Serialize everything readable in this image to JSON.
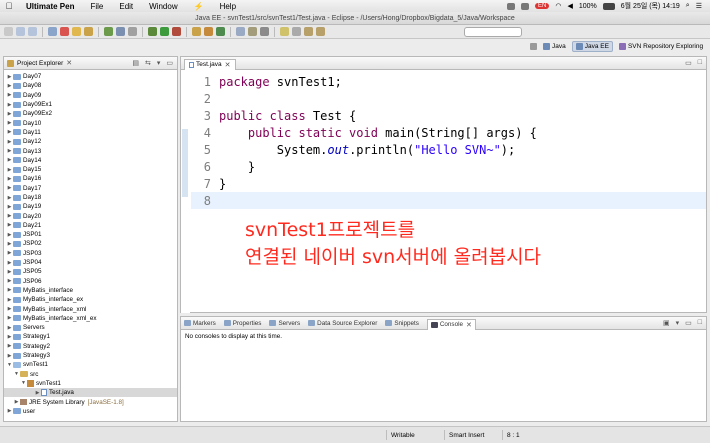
{
  "menubar": {
    "app_name": "Ultimate Pen",
    "items": [
      "File",
      "Edit",
      "Window",
      "Help"
    ],
    "battery": "100%",
    "datetime": "6월 25일 (목)  14:19"
  },
  "window": {
    "title": "Java EE - svnTest1/src/svnTest1/Test.java - Eclipse - /Users/Hong/Dropbox/Bigdata_5/Java/Workspace"
  },
  "perspectives": [
    "Java",
    "Java EE",
    "SVN Repository Exploring"
  ],
  "explorer": {
    "tab_label": "Project Explorer",
    "tab_close": "✕",
    "projects": [
      "Day07",
      "Day08",
      "Day09",
      "Day09Ex1",
      "Day09Ex2",
      "Day10",
      "Day11",
      "Day12",
      "Day13",
      "Day14",
      "Day15",
      "Day16",
      "Day17",
      "Day18",
      "Day19",
      "Day20",
      "Day21",
      "JSP01",
      "JSP02",
      "JSP03",
      "JSP04",
      "JSP05",
      "JSP06",
      "MyBatis_interface",
      "MyBatis_interface_ex",
      "MyBatis_interface_xml",
      "MyBatis_interface_xml_ex",
      "Servers",
      "Strategy1",
      "Strategy2",
      "Strategy3"
    ],
    "open_project": "svnTest1",
    "src_folder": "src",
    "package": "svnTest1",
    "file": "Test.java",
    "jre_label": "JRE System Library",
    "jre_version": "[JavaSE-1.8]",
    "last_project": "user"
  },
  "editor": {
    "tab_label": "Test.java",
    "tab_close": "✕",
    "line_numbers": [
      "1",
      "2",
      "3",
      "4",
      "5",
      "6",
      "7",
      "8"
    ],
    "code": {
      "l1_kw": "package",
      "l1_rest": " svnTest1;",
      "l3_kw": "public class",
      "l3_rest": " Test {",
      "l4_indent": "    ",
      "l4_kw": "public static void",
      "l4_rest": " main(String[] args) {",
      "l5_pre": "        System.",
      "l5_field": "out",
      "l5_mid": ".println(",
      "l5_str": "\"Hello SVN~\"",
      "l5_end": ");",
      "l6": "    }",
      "l7": "}"
    },
    "annotation_line1": "svnTest1프로젝트를",
    "annotation_line2": "연결된 네이버 svn서버에 올려봅시다"
  },
  "console": {
    "tabs": [
      "Markers",
      "Properties",
      "Servers",
      "Data Source Explorer",
      "Snippets"
    ],
    "active_tab": "Console",
    "active_close": "✕",
    "message": "No consoles to display at this time."
  },
  "statusbar": {
    "mode": "Writable",
    "insert": "Smart Insert",
    "position": "8 : 1"
  }
}
